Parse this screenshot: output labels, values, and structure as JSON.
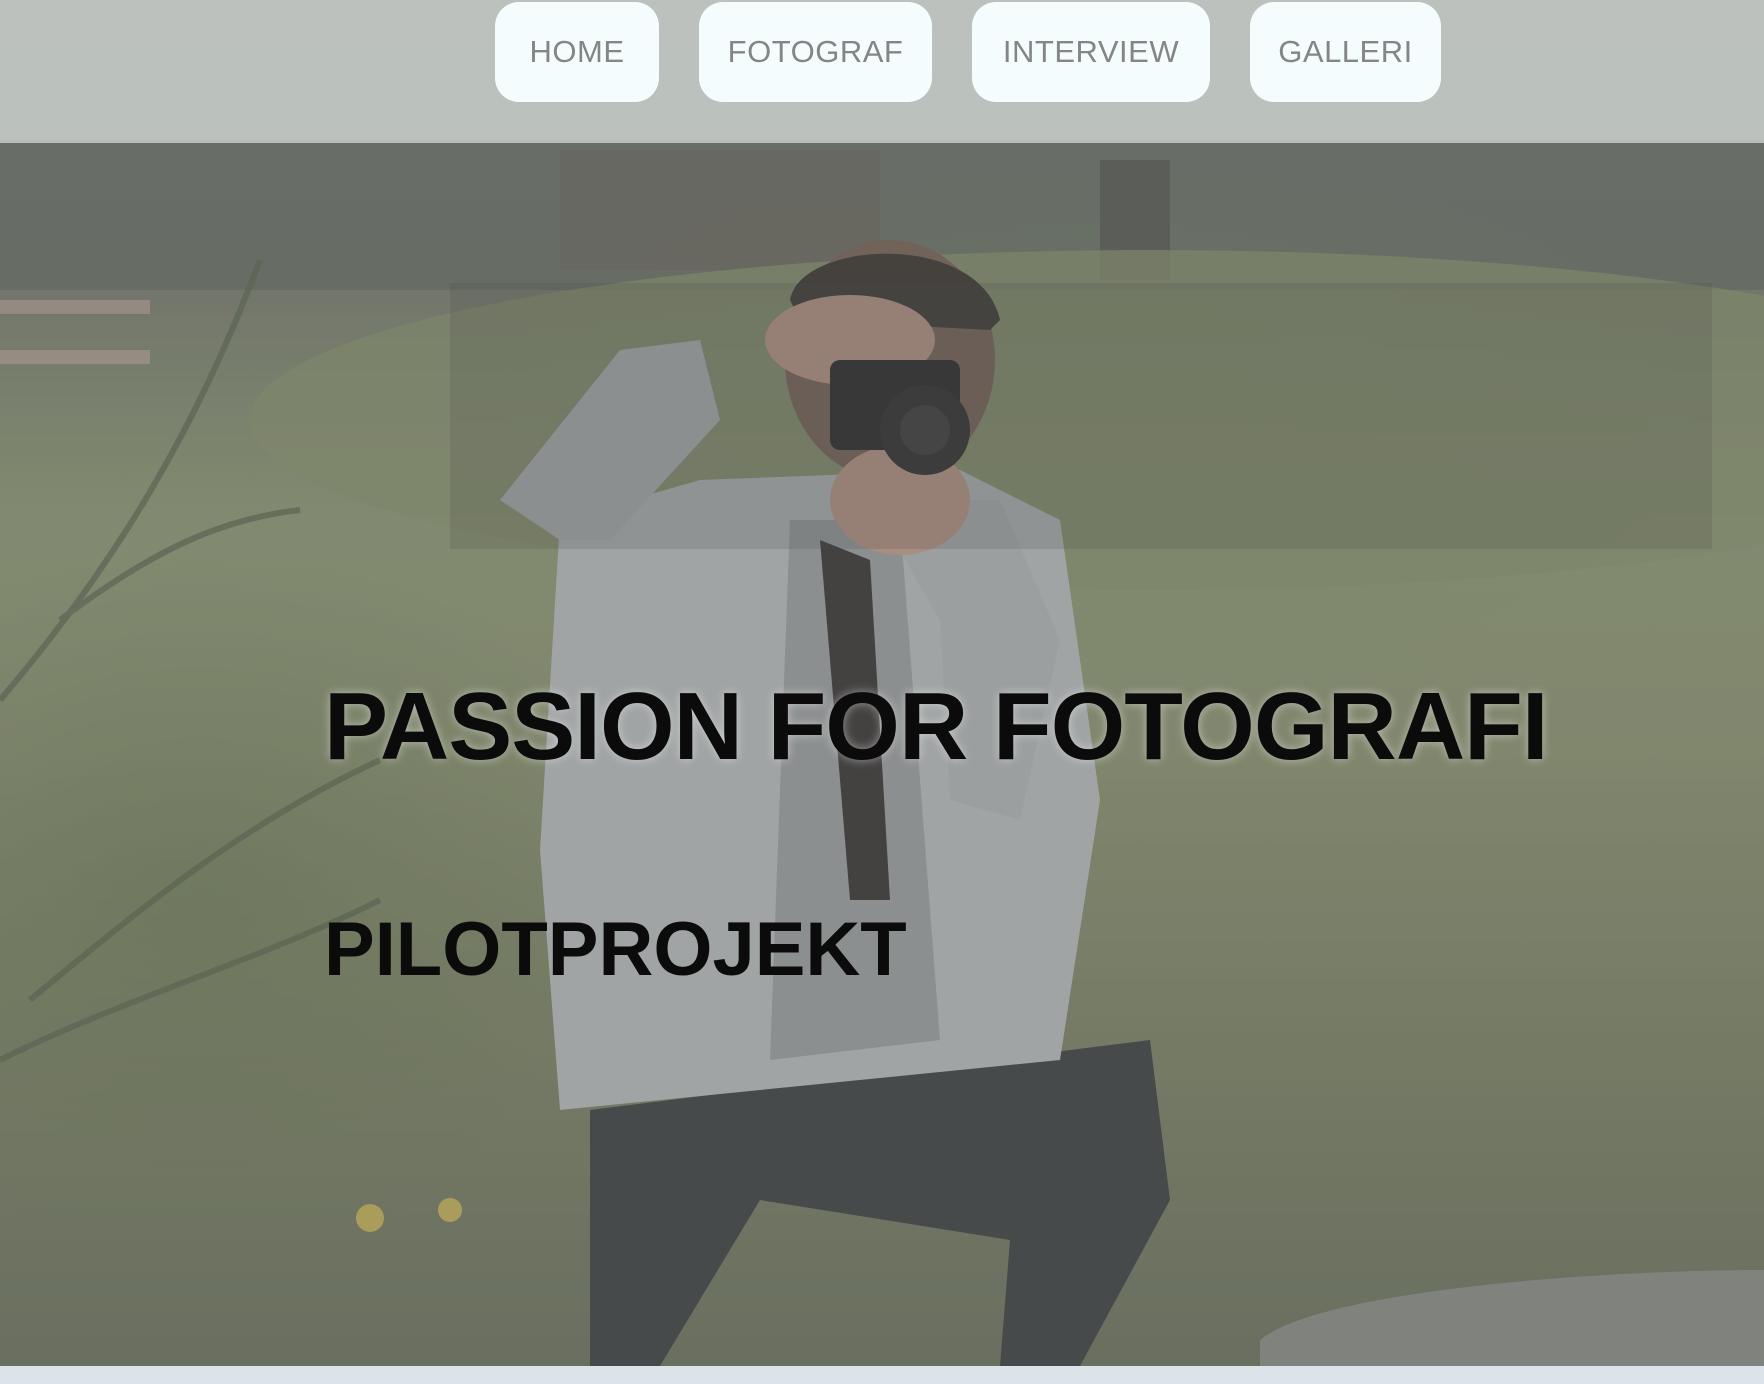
{
  "nav": {
    "items": [
      {
        "label": "HOME"
      },
      {
        "label": "FOTOGRAF"
      },
      {
        "label": "INTERVIEW"
      },
      {
        "label": "GALLERI"
      }
    ]
  },
  "hero": {
    "title": "PASSION FOR FOTOGRAFI",
    "subtitle": "PILOTPROJEKT",
    "image": "photographer-with-camera-photo"
  },
  "colors": {
    "nav_button_bg": "#f4fcfd",
    "nav_text": "#858585",
    "heading_text": "#0b0b0b"
  }
}
